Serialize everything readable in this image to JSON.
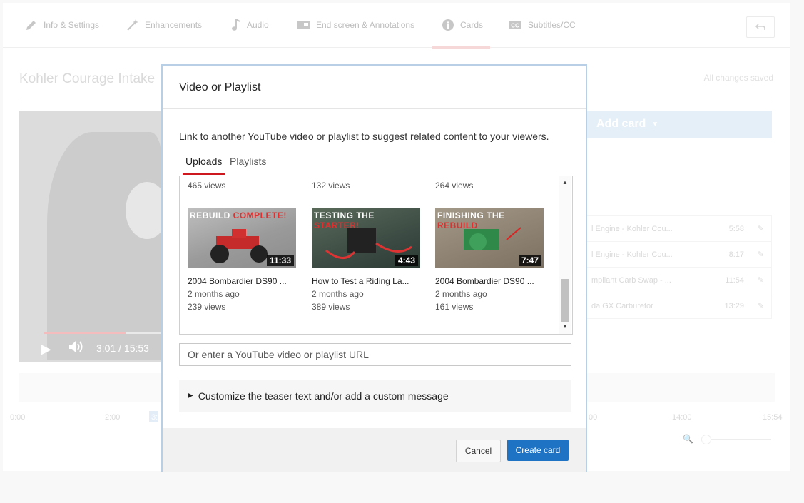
{
  "tabs": [
    {
      "label": "Info & Settings",
      "icon": "pencil-icon"
    },
    {
      "label": "Enhancements",
      "icon": "magic-wand-icon"
    },
    {
      "label": "Audio",
      "icon": "music-note-icon"
    },
    {
      "label": "End screen & Annotations",
      "icon": "end-screen-icon"
    },
    {
      "label": "Cards",
      "icon": "info-icon"
    },
    {
      "label": "Subtitles/CC",
      "icon": "cc-icon"
    }
  ],
  "video_title": "Kohler Courage Intake",
  "save_status": "All changes saved",
  "player": {
    "time": "3:01 / 15:53",
    "progress": 0.19
  },
  "add_card_label": "Add card",
  "cards": [
    {
      "title": "l Engine - Kohler Cou...",
      "duration": "5:58"
    },
    {
      "title": "l Engine - Kohler Cou...",
      "duration": "8:17"
    },
    {
      "title": "mpliant Carb Swap - ...",
      "duration": "11:54"
    },
    {
      "title": "da GX Carburetor",
      "duration": "13:29"
    }
  ],
  "timeline": {
    "ticks": [
      "0:00",
      "2:00",
      "3:",
      "00",
      "14:00",
      "15:54"
    ]
  },
  "modal": {
    "title": "Video or Playlist",
    "description": "Link to another YouTube video or playlist to suggest related content to your viewers.",
    "tabs": [
      "Uploads",
      "Playlists"
    ],
    "top_views": [
      "465 views",
      "132 views",
      "264 views"
    ],
    "videos": [
      {
        "caption_a": "REBUILD ",
        "caption_b": "COMPLETE!",
        "duration": "11:33",
        "title": "2004 Bombardier DS90 ...",
        "age": "2 months ago",
        "views": "239 views"
      },
      {
        "caption_a": "TESTING THE ",
        "caption_b": "STARTER!",
        "duration": "4:43",
        "title": "How to Test a Riding La...",
        "age": "2 months ago",
        "views": "389 views"
      },
      {
        "caption_a": "FINISHING THE ",
        "caption_b": "REBUILD",
        "duration": "7:47",
        "title": "2004 Bombardier DS90 ...",
        "age": "2 months ago",
        "views": "161 views"
      }
    ],
    "url_placeholder": "Or enter a YouTube video or playlist URL",
    "customize_label": "Customize the teaser text and/or add a custom message",
    "cancel_label": "Cancel",
    "create_label": "Create card"
  }
}
